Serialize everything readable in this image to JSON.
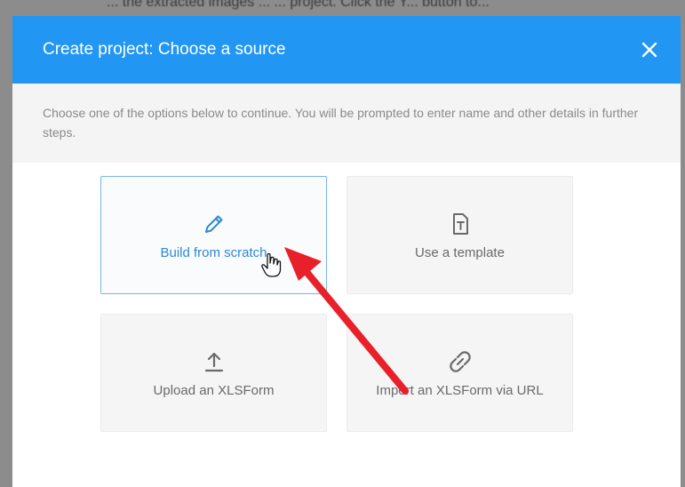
{
  "background": {
    "partial_text": "... the extracted images ... ... project. Click the Y... button to..."
  },
  "modal": {
    "title": "Create project: Choose a source",
    "close_icon": "close-icon",
    "intro": "Choose one of the options below to continue. You will be prompted to enter name and other details in further steps."
  },
  "options": [
    {
      "label": "Build from scratch",
      "icon": "pencil-icon",
      "selected": true
    },
    {
      "label": "Use a template",
      "icon": "template-icon",
      "selected": false
    },
    {
      "label": "Upload an XLSForm",
      "icon": "upload-icon",
      "selected": false
    },
    {
      "label": "Import an XLSForm via URL",
      "icon": "link-icon",
      "selected": false
    }
  ],
  "colors": {
    "header": "#2196f3",
    "accent": "#2f88d3",
    "annotation_arrow": "#e8202a"
  }
}
